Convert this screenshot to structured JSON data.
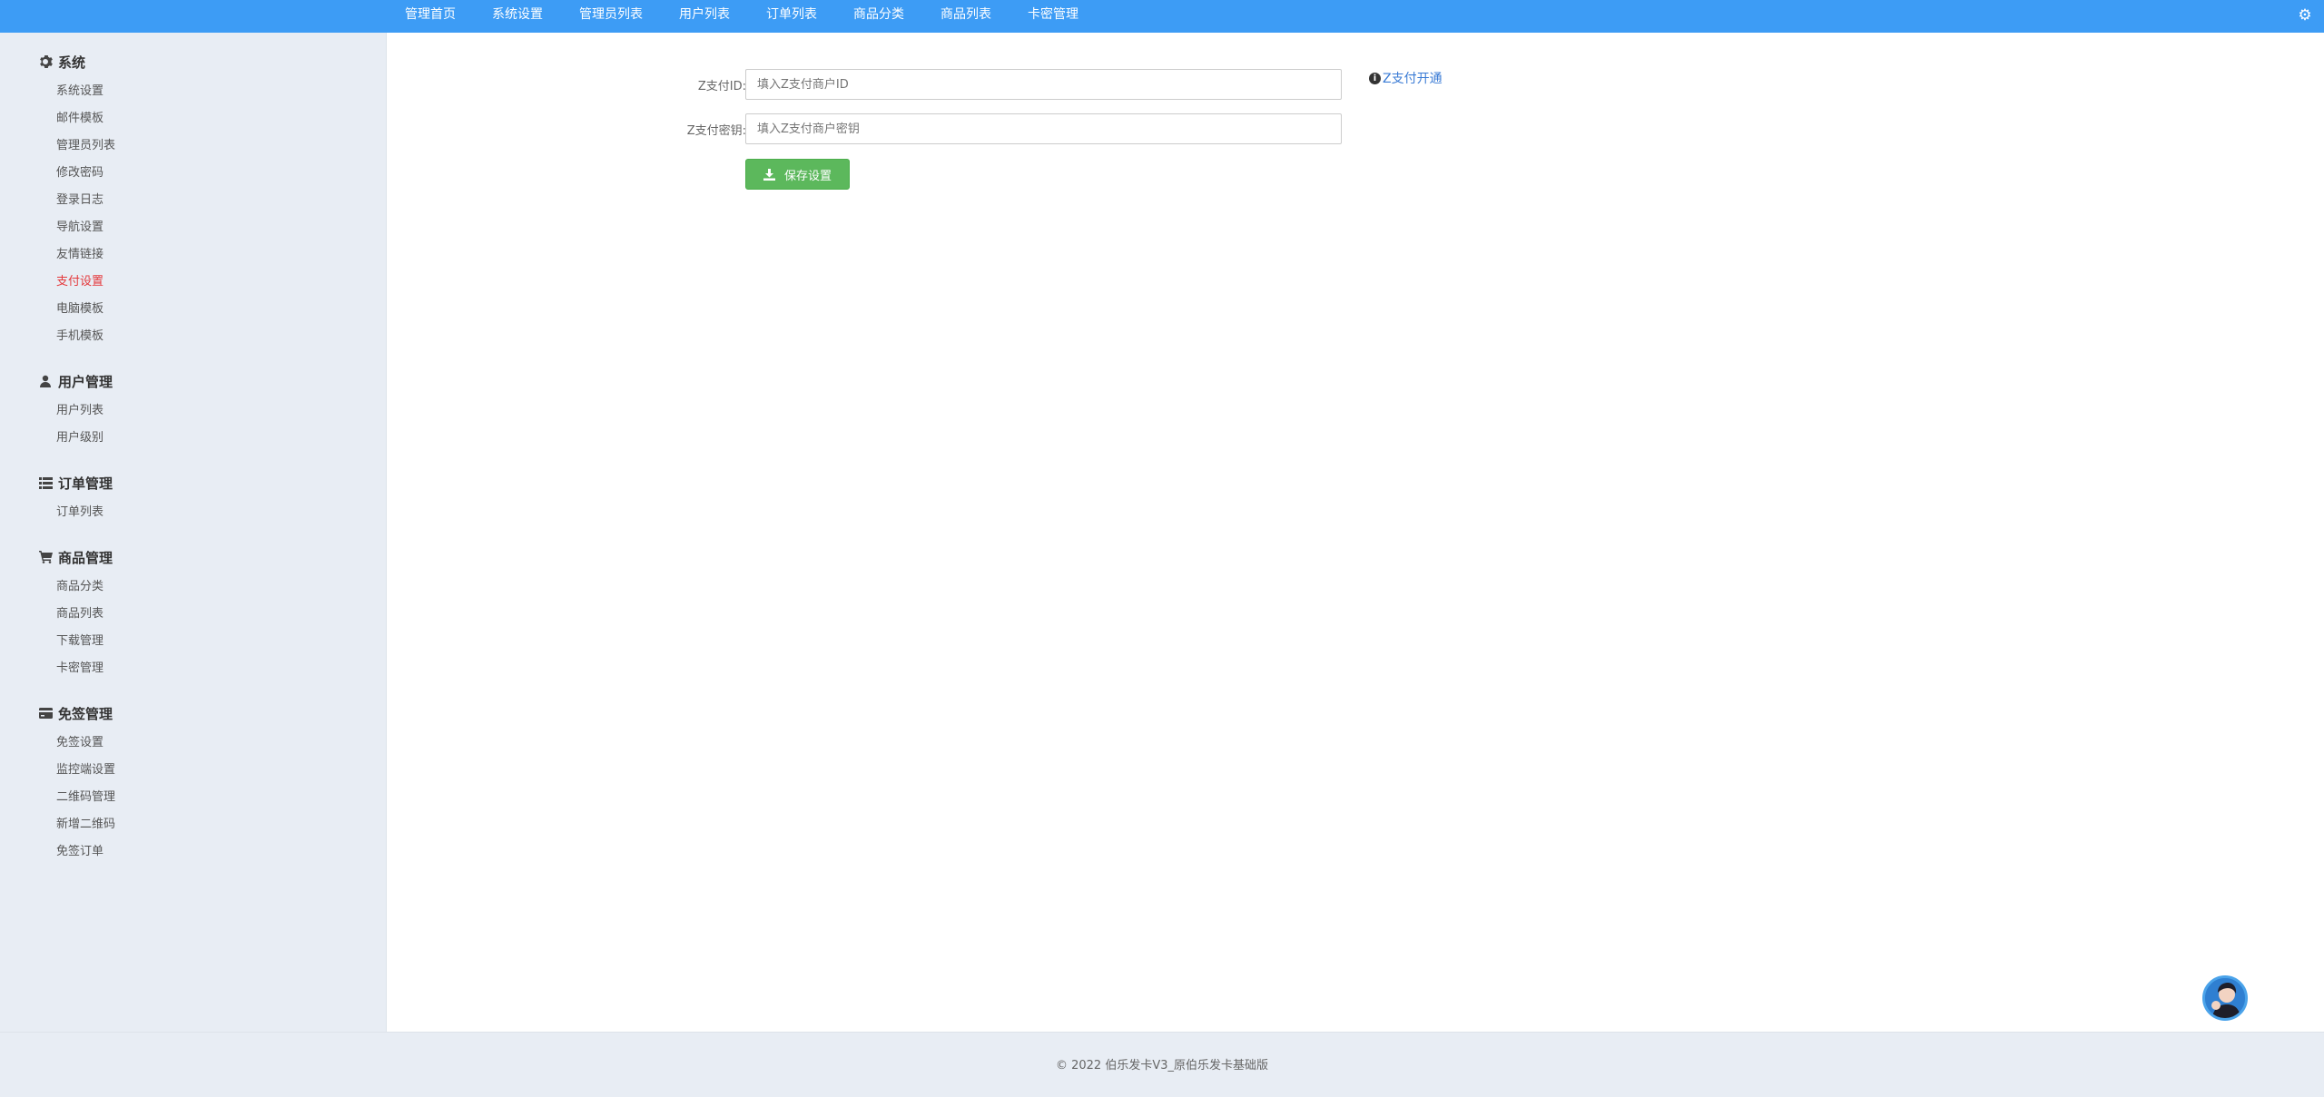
{
  "topnav": {
    "items": [
      "管理首页",
      "系统设置",
      "管理员列表",
      "用户列表",
      "订单列表",
      "商品分类",
      "商品列表",
      "卡密管理"
    ],
    "settings_icon": "gear-icon"
  },
  "sidebar": {
    "sections": [
      {
        "title": "系统",
        "icon": "gear-icon",
        "items": [
          "系统设置",
          "邮件模板",
          "管理员列表",
          "修改密码",
          "登录日志",
          "导航设置",
          "友情链接",
          "支付设置",
          "电脑模板",
          "手机模板"
        ]
      },
      {
        "title": "用户管理",
        "icon": "user-icon",
        "items": [
          "用户列表",
          "用户级别"
        ]
      },
      {
        "title": "订单管理",
        "icon": "list-icon",
        "items": [
          "订单列表"
        ]
      },
      {
        "title": "商品管理",
        "icon": "cart-icon",
        "items": [
          "商品分类",
          "商品列表",
          "下载管理",
          "卡密管理"
        ]
      },
      {
        "title": "免签管理",
        "icon": "card-icon",
        "items": [
          "免签设置",
          "监控端设置",
          "二维码管理",
          "新增二维码",
          "免签订单"
        ]
      }
    ],
    "active_item": "支付设置"
  },
  "form": {
    "zpay_id_label": "Z支付ID:",
    "zpay_id_placeholder": "填入Z支付商户ID",
    "zpay_key_label": "Z支付密钥:",
    "zpay_key_placeholder": "填入Z支付商户密钥",
    "save_label": "保存设置",
    "help_link": "Z支付开通"
  },
  "footer": {
    "text": "© 2022 伯乐发卡V3_原伯乐发卡基础版"
  },
  "colors": {
    "topbar": "#3d9cf5",
    "active_menu": "#e4393c",
    "save_button": "#5cb85c",
    "link": "#3a7bd5"
  }
}
